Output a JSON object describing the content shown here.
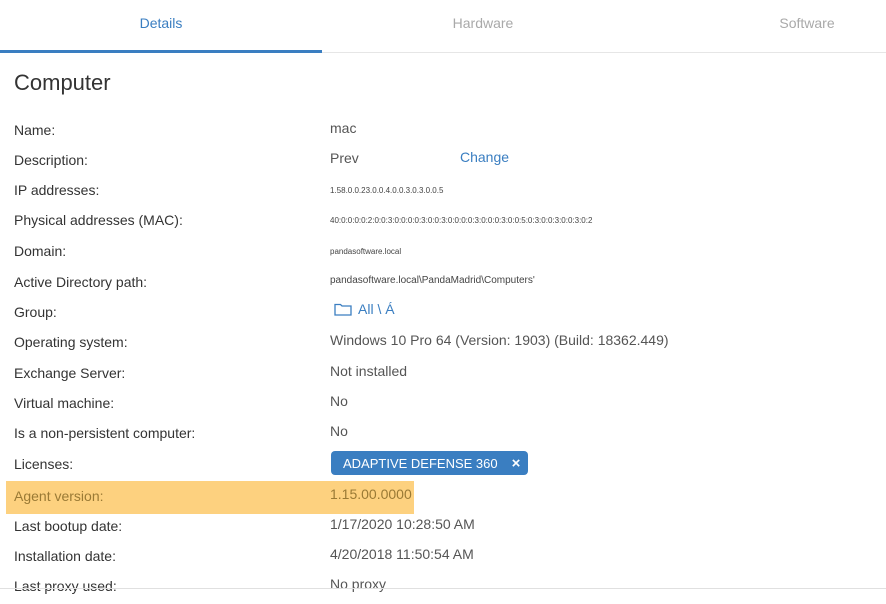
{
  "tabs": [
    {
      "label": "Details",
      "active": true
    },
    {
      "label": "Hardware",
      "active": false
    },
    {
      "label": "Software",
      "active": false
    }
  ],
  "section_title": "Computer",
  "rows": {
    "name": {
      "label": "Name:",
      "value": "mac"
    },
    "description": {
      "label": "Description:",
      "value": "Prev",
      "action": "Change"
    },
    "ip": {
      "label": "IP addresses:",
      "value": "1.58.0.0.23.0.0.4.0.0.3.0.3.0.0.5"
    },
    "mac": {
      "label": "Physical addresses (MAC):",
      "value": "40:0:0:0:0:2:0:0:3:0:0:0:0:3:0:0:3:0:0:0:0:3:0:0:0:3:0:0:5:0:3:0:0:3:0:0:3:0:2"
    },
    "domain": {
      "label": "Domain:",
      "value": "pandasoftware.local"
    },
    "ad_path": {
      "label": "Active Directory path:",
      "value": "pandasoftware.local\\PandaMadrid\\Computers'"
    },
    "group": {
      "label": "Group:",
      "value": "All \\ Á"
    },
    "os": {
      "label": "Operating system:",
      "value": "Windows 10 Pro 64 (Version: 1903) (Build: 18362.449)"
    },
    "exchange": {
      "label": "Exchange Server:",
      "value": "Not installed"
    },
    "vm": {
      "label": "Virtual machine:",
      "value": "No"
    },
    "nonpersistent": {
      "label": "Is a non-persistent computer:",
      "value": "No"
    },
    "licenses": {
      "label": "Licenses:",
      "chip": "ADAPTIVE DEFENSE 360",
      "chip_close": "×"
    },
    "agent": {
      "label": "Agent version:",
      "value": "1.15.00.0000"
    },
    "bootup": {
      "label": "Last bootup date:",
      "value": "1/17/2020 10:28:50 AM"
    },
    "install": {
      "label": "Installation date:",
      "value": "4/20/2018 11:50:54 AM"
    },
    "proxy": {
      "label": "Last proxy used:",
      "value": "No proxy"
    }
  },
  "colors": {
    "accent": "#3a7ec1",
    "highlight": "#fdd17f"
  }
}
